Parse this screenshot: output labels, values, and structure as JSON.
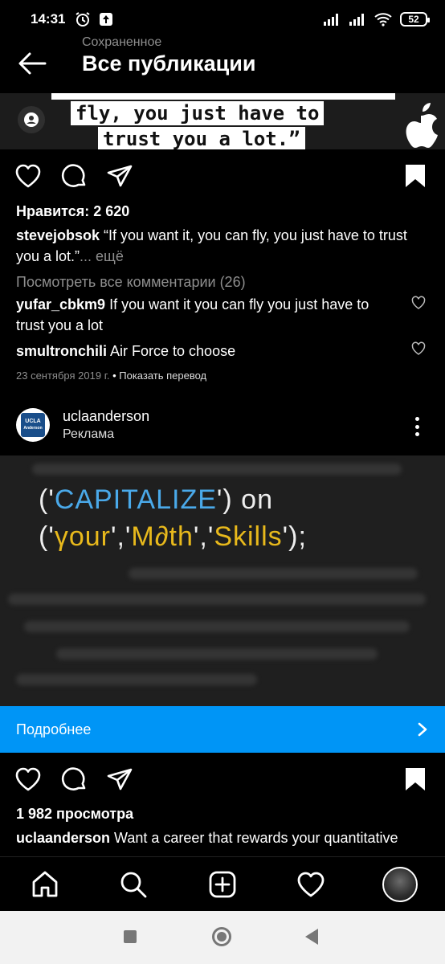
{
  "status_bar": {
    "time": "14:31",
    "battery": "52"
  },
  "header": {
    "subtitle": "Сохраненное",
    "title": "Все публикации"
  },
  "top_post": {
    "image_quote_line1": "fly, you just have to",
    "image_quote_line2": "trust you a lot.”",
    "likes": "Нравится: 2 620",
    "caption_user": "stevejobsok",
    "caption_line1": " “If you want it, you can fly, you just have to trust",
    "caption_line2": "you a lot.”",
    "caption_more": "... ещё",
    "view_comments": "Посмотреть все комментарии (26)",
    "comments": [
      {
        "user": "yufar_cbkm9",
        "text_line1": " If you want it you can fly you just have to",
        "text_line2": "trust you a lot"
      },
      {
        "user": "smultronchili",
        "text_line1": " Air Force to choose"
      }
    ],
    "date": "23 сентября 2019 г.",
    "separator": " • ",
    "translate": "Показать перевод"
  },
  "ad_post": {
    "avatar_line1": "UCLA",
    "avatar_line2": "Anderson",
    "user": "uclaanderson",
    "label": "Реклама",
    "image_code_line1": {
      "p1": "('",
      "p2": "CAPITALIZE",
      "p3": "') on"
    },
    "image_code_line2": {
      "p1": "('",
      "p2": "γour",
      "p3": "','",
      "p4": "M∂th",
      "p5": "','",
      "p6": "Skills",
      "p7": "');"
    },
    "cta_label": "Подробнее",
    "views": "1 982 просмотра",
    "caption_user": "uclaanderson",
    "caption_line1": " Want a career that rewards your quantitative"
  },
  "colors": {
    "accent": "#0095f6",
    "code_blue": "#4aa9e9",
    "code_gold": "#e8b91c"
  }
}
